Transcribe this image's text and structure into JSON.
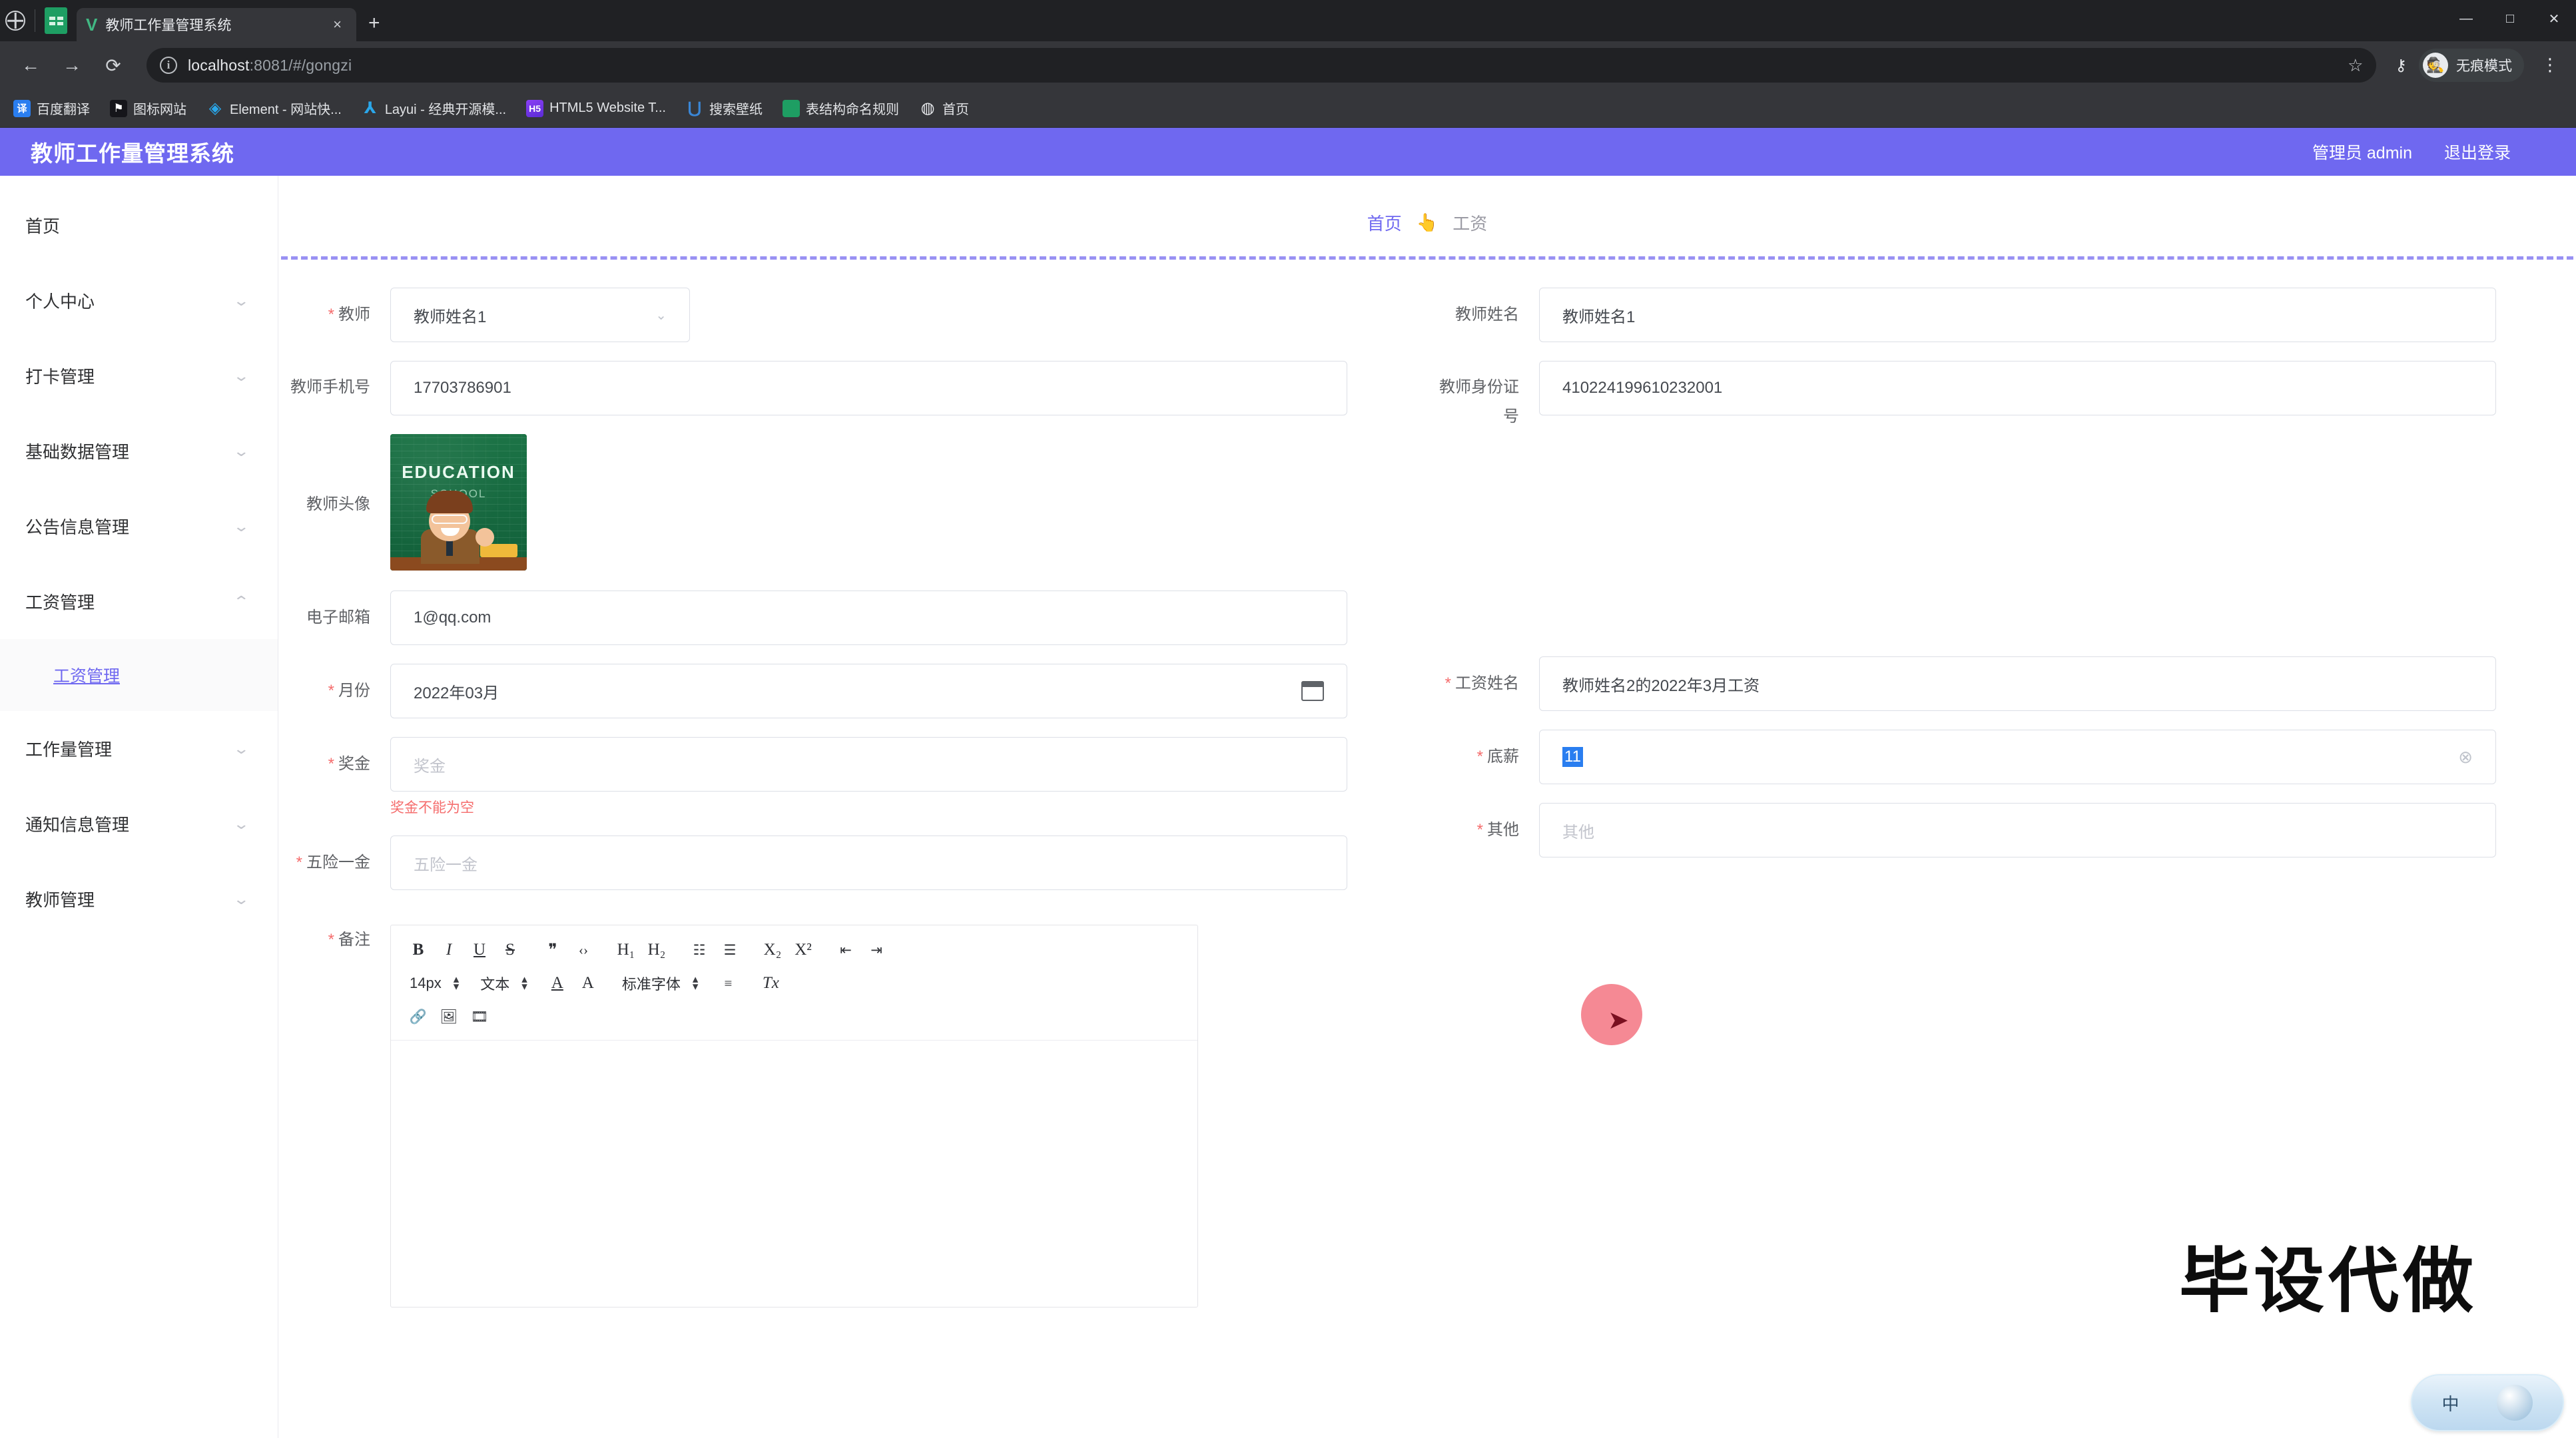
{
  "browser": {
    "tab": {
      "title": "教师工作量管理系统",
      "favicon": "vue-icon",
      "close_label": "×"
    },
    "new_tab_label": "+",
    "window_controls": {
      "minimize": "—",
      "maximize": "□",
      "close": "✕"
    },
    "nav": {
      "back": "←",
      "forward": "→",
      "reload": "⟳"
    },
    "omnibox": {
      "info_icon": "ⓘ",
      "url_host": "localhost",
      "url_rest": ":8081/#/gongzi",
      "star_icon": "☆"
    },
    "toolbar_right": {
      "key_icon": "⚷",
      "incognito_label": "无痕模式",
      "menu_icon": "⋮"
    },
    "bookmarks": [
      {
        "label": "百度翻译",
        "icon": "baidu-translate-icon",
        "glyph": "译"
      },
      {
        "label": "图标网站",
        "icon": "flag-icon",
        "glyph": "⚑"
      },
      {
        "label": "Element - 网站快...",
        "icon": "element-icon",
        "glyph": "◈"
      },
      {
        "label": "Layui - 经典开源模...",
        "icon": "layui-icon",
        "glyph": "⅄"
      },
      {
        "label": "HTML5 Website T...",
        "icon": "html5-icon",
        "glyph": "H5"
      },
      {
        "label": "搜索壁纸",
        "icon": "wallpaper-icon",
        "glyph": "⋃"
      },
      {
        "label": "表结构命名规则",
        "icon": "sheet-icon",
        "glyph": ""
      },
      {
        "label": "首页",
        "icon": "globe-icon",
        "glyph": "🌐"
      }
    ]
  },
  "app": {
    "title": "教师工作量管理系统",
    "user": "管理员 admin",
    "logout": "退出登录",
    "sidebar": [
      {
        "label": "首页",
        "has_chevron": false,
        "active": false
      },
      {
        "label": "个人中心",
        "has_chevron": true,
        "active": false
      },
      {
        "label": "打卡管理",
        "has_chevron": true,
        "active": false
      },
      {
        "label": "基础数据管理",
        "has_chevron": true,
        "active": false
      },
      {
        "label": "公告信息管理",
        "has_chevron": true,
        "active": false
      },
      {
        "label": "工资管理",
        "has_chevron": true,
        "active": false
      },
      {
        "label": "工资管理",
        "has_chevron": false,
        "active": true,
        "sub": true
      },
      {
        "label": "工作量管理",
        "has_chevron": true,
        "active": false
      },
      {
        "label": "通知信息管理",
        "has_chevron": true,
        "active": false
      },
      {
        "label": "教师管理",
        "has_chevron": true,
        "active": false
      }
    ],
    "breadcrumb": {
      "home": "首页",
      "separator": "👆",
      "current": "工资"
    },
    "form": {
      "left": [
        {
          "name": "teacher",
          "label": "教师",
          "required": true,
          "value": "教师姓名1",
          "type": "select",
          "caret": "⌄"
        },
        {
          "name": "teacher-phone",
          "label": "教师手机号",
          "required": false,
          "value": "17703786901",
          "type": "text"
        },
        {
          "name": "teacher-avatar",
          "label": "教师头像",
          "required": false,
          "type": "image",
          "image_alt": "EDUCATION",
          "image_caption": "EDUCATION",
          "image_subcaption": "SCHOOL"
        },
        {
          "name": "email",
          "label": "电子邮箱",
          "required": false,
          "value": "1@qq.com",
          "type": "text"
        },
        {
          "name": "month",
          "label": "月份",
          "required": true,
          "value": "2022年03月",
          "type": "date"
        },
        {
          "name": "bonus",
          "label": "奖金",
          "required": true,
          "value": "",
          "placeholder": "奖金",
          "type": "text",
          "error": "奖金不能为空"
        },
        {
          "name": "insurance",
          "label": "五险一金",
          "required": true,
          "value": "",
          "placeholder": "五险一金",
          "type": "text"
        }
      ],
      "right": [
        {
          "name": "teacher-name",
          "label": "教师姓名",
          "required": false,
          "value": "教师姓名1",
          "type": "text"
        },
        {
          "name": "teacher-id-card",
          "label": "教师身份证号",
          "required": false,
          "value": "410224199610232001",
          "type": "text"
        },
        {
          "name": "salary-name",
          "label": "工资姓名",
          "required": true,
          "value": "教师姓名2的2022年3月工资",
          "type": "text"
        },
        {
          "name": "base-salary",
          "label": "底薪",
          "required": true,
          "value": "11",
          "type": "text",
          "selected": true,
          "clear_icon": "⊗"
        },
        {
          "name": "other",
          "label": "其他",
          "required": true,
          "value": "",
          "placeholder": "其他",
          "type": "text"
        }
      ],
      "remark": {
        "label": "备注",
        "required": true,
        "toolbar_row1": [
          {
            "name": "bold",
            "glyph": "B"
          },
          {
            "name": "italic",
            "glyph": "I"
          },
          {
            "name": "underline",
            "glyph": "U"
          },
          {
            "name": "strikethrough",
            "glyph": "S"
          },
          {
            "name": "blockquote",
            "glyph": "❞"
          },
          {
            "name": "code",
            "glyph": "‹›"
          },
          {
            "name": "heading-1",
            "glyph": "H₁"
          },
          {
            "name": "heading-2",
            "glyph": "H₂"
          },
          {
            "name": "ordered-list",
            "glyph": "☷"
          },
          {
            "name": "unordered-list",
            "glyph": "☰"
          },
          {
            "name": "subscript",
            "glyph": "X₂"
          },
          {
            "name": "superscript",
            "glyph": "X²"
          },
          {
            "name": "outdent",
            "glyph": "⇤"
          },
          {
            "name": "indent",
            "glyph": "⇥"
          }
        ],
        "toolbar_row2": {
          "font_size": "14px",
          "text_style": "文本",
          "font_color": "A",
          "bg_color": "A",
          "font_family": "标准字体",
          "align": "≡",
          "clear_format": "Tx"
        },
        "toolbar_row3": [
          {
            "name": "link",
            "glyph": "🔗"
          },
          {
            "name": "image",
            "glyph": "🖼"
          },
          {
            "name": "video",
            "glyph": "🎞"
          }
        ]
      }
    }
  },
  "overlay": {
    "watermark": "毕设代做",
    "ime_mode": "中"
  }
}
